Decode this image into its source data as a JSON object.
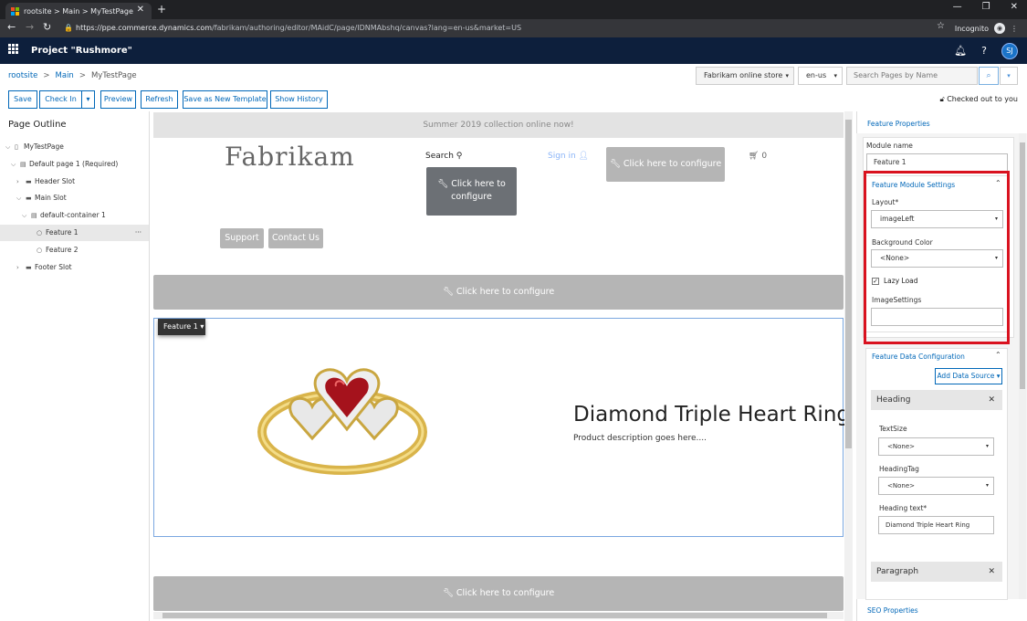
{
  "browser": {
    "tab_title": "rootsite > Main > MyTestPage",
    "url_host": "https://ppe.commerce.dynamics.com",
    "url_path": "/fabrikam/authoring/editor/MAidC/page/IDNMAbshq/canvas?lang=en-us&market=US",
    "incognito_label": "Incognito"
  },
  "appbar": {
    "project_title": "Project \"Rushmore\"",
    "user_initials": "SJ"
  },
  "breadcrumb": {
    "items": [
      "rootsite",
      "Main",
      "MyTestPage"
    ]
  },
  "selectors": {
    "store": "Fabrikam online store",
    "locale": "en-us",
    "search_placeholder": "Search Pages by Name"
  },
  "toolbar": {
    "save": "Save",
    "check_in": "Check In",
    "preview": "Preview",
    "refresh": "Refresh",
    "save_template": "Save as New Template",
    "show_history": "Show History",
    "status": "Checked out to you"
  },
  "outline": {
    "title": "Page Outline",
    "items": [
      {
        "label": "MyTestPage",
        "icon": "page-icon"
      },
      {
        "label": "Default page 1 (Required)",
        "icon": "layout-icon"
      },
      {
        "label": "Header Slot",
        "icon": "slot-icon"
      },
      {
        "label": "Main Slot",
        "icon": "slot-icon"
      },
      {
        "label": "default-container 1",
        "icon": "container-icon"
      },
      {
        "label": "Feature 1",
        "icon": "module-icon",
        "more": "···"
      },
      {
        "label": "Feature 2",
        "icon": "module-icon"
      },
      {
        "label": "Footer Slot",
        "icon": "slot-icon"
      }
    ]
  },
  "canvas": {
    "promo": "Summer 2019 collection online now!",
    "logo": "Fabrikam",
    "search": "Search",
    "sign_in": "Sign in",
    "configure": "Click here to configure",
    "cart_count": "0",
    "support": "Support",
    "contact": "Contact Us",
    "feature_tag": "Feature 1",
    "feature_heading": "Diamond Triple Heart Ring",
    "feature_desc": "Product description goes here...."
  },
  "properties": {
    "title": "Feature Properties",
    "module_name_label": "Module name",
    "module_name_value": "Feature 1",
    "settings_header": "Feature Module Settings",
    "layout_label": "Layout*",
    "layout_value": "imageLeft",
    "bg_label": "Background Color",
    "bg_value": "<None>",
    "lazy_label": "Lazy Load",
    "lazy_checked": true,
    "image_settings_label": "ImageSettings",
    "data_header": "Feature Data Configuration",
    "add_source": "Add Data Source",
    "heading_section": "Heading",
    "text_size_label": "TextSize",
    "text_size_value": "<None>",
    "heading_tag_label": "HeadingTag",
    "heading_tag_value": "<None>",
    "heading_text_label": "Heading text*",
    "heading_text_value": "Diamond Triple Heart Ring",
    "paragraph_section": "Paragraph",
    "seo_link": "SEO Properties"
  },
  "colors": {
    "appbar": "#0d1f3c",
    "accent": "#0067b8",
    "highlight_box": "#d9121f"
  }
}
